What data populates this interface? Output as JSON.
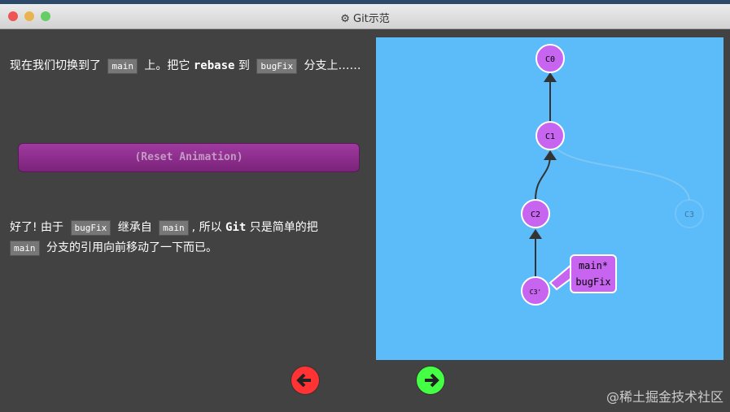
{
  "window": {
    "title": "Git示范",
    "title_icon": "gear-icon"
  },
  "para1": {
    "a": "现在我们切换到了",
    "code1": "main",
    "b": "上。把它",
    "bold": "rebase",
    "c": "到",
    "code2": "bugFix",
    "d": "分支上……"
  },
  "reset_label": "(Reset Animation)",
  "para2": {
    "a": "好了! 由于",
    "code1": "bugFix",
    "b": "继承自",
    "code2": "main",
    "c": ", 所以",
    "bold": "Git",
    "d": "只是简单的把",
    "code3": "main",
    "e": "分支的引用向前移动了一下而已。"
  },
  "graph": {
    "commits": [
      "C0",
      "C1",
      "C2",
      "C3'",
      "C3"
    ],
    "branch_label": [
      "main*",
      "bugFix"
    ]
  },
  "nav": {
    "back": "arrow-left-icon",
    "forward": "arrow-right-icon"
  },
  "colors": {
    "commit": "#c865f0",
    "canvas": "#5cbbf9",
    "back": "#f44",
    "forward": "#5f5"
  },
  "watermark": "@稀土掘金技术社区"
}
